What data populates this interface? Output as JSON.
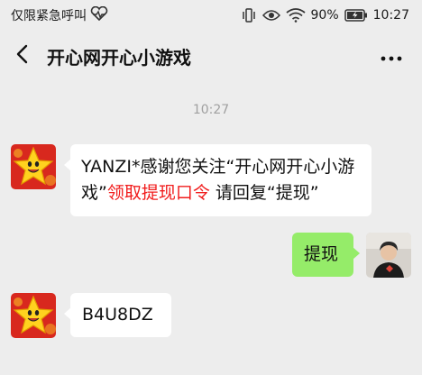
{
  "status_bar": {
    "carrier": "仅限紧急呼叫",
    "battery_percent": "90%",
    "time": "10:27",
    "icons": [
      "heart-monitor-icon",
      "vibrate-icon",
      "eye-icon",
      "wifi-icon",
      "battery-icon"
    ]
  },
  "nav": {
    "title": "开心网开心小游戏",
    "back_icon": "back-arrow-icon",
    "more_icon": "more-dots-icon"
  },
  "chat": {
    "timestamp": "10:27",
    "messages": [
      {
        "side": "left",
        "sender": "bot",
        "segments": [
          {
            "text": "YANZI*感谢您关注“开心网开心小游戏”",
            "color": "#111111"
          },
          {
            "text": "领取提现口令",
            "color": "#f11c1c"
          },
          {
            "text": " 请回复“提现”",
            "color": "#111111"
          }
        ]
      },
      {
        "side": "right",
        "sender": "user",
        "text": "提现"
      },
      {
        "side": "left",
        "sender": "bot",
        "text": "B4U8DZ"
      }
    ]
  },
  "colors": {
    "background": "#ededed",
    "bubble_left": "#ffffff",
    "bubble_right": "#95ec69",
    "highlight": "#f11c1c"
  }
}
